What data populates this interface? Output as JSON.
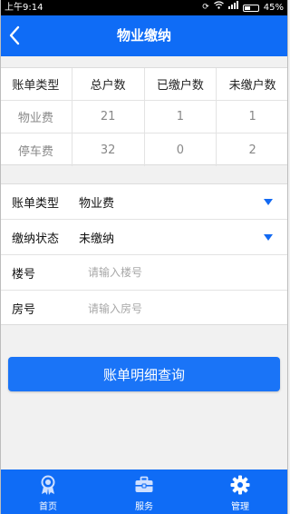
{
  "status_bar": {
    "time": "上午9:14",
    "battery_percent": "45%",
    "battery_level": 0.45
  },
  "header": {
    "title": "物业缴纳",
    "back_icon": "chevron-left-icon"
  },
  "summary_table": {
    "columns": [
      "账单类型",
      "总户数",
      "已缴户数",
      "未缴户数"
    ],
    "rows": [
      [
        "物业费",
        "21",
        "1",
        "1"
      ],
      [
        "停车费",
        "32",
        "0",
        "2"
      ]
    ]
  },
  "form": {
    "bill_type": {
      "label": "账单类型",
      "value": "物业费"
    },
    "pay_status": {
      "label": "缴纳状态",
      "value": "未缴纳"
    },
    "building": {
      "label": "楼号",
      "placeholder": "请输入楼号",
      "value": ""
    },
    "room": {
      "label": "房号",
      "placeholder": "请输入房号",
      "value": ""
    }
  },
  "query_button": {
    "label": "账单明细查询"
  },
  "bottom_nav": {
    "items": [
      {
        "label": "首页",
        "icon": "home-badge-icon"
      },
      {
        "label": "服务",
        "icon": "briefcase-icon"
      },
      {
        "label": "管理",
        "icon": "gear-icon"
      }
    ]
  },
  "colors": {
    "brand_blue": "#0f6cf6",
    "button_blue": "#1a74f7",
    "background": "#f1f1f1"
  }
}
